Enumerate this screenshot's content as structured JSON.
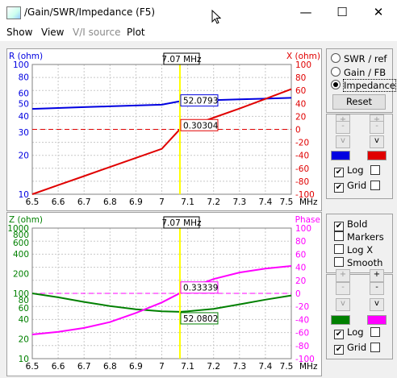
{
  "window": {
    "title": "/Gain/SWR/Impedance (F5)",
    "minimize": "—",
    "maximize": "☐",
    "close": "✕"
  },
  "menu": [
    "Show",
    "View",
    "V/I source",
    "Plot"
  ],
  "cursor_freq_label": "7.07 MHz",
  "top_panel": {
    "left_axis_title": "R (ohm)",
    "right_axis_title": "X (ohm)",
    "left_ticks": [
      "100",
      "80",
      "60",
      "50",
      "40",
      "30",
      "20",
      "10"
    ],
    "right_ticks": [
      "100",
      "80",
      "60",
      "40",
      "20",
      "0",
      "-20",
      "-40",
      "-60",
      "-80",
      "-100"
    ],
    "x_ticks": [
      "6.5",
      "6.6",
      "6.7",
      "6.8",
      "6.9",
      "7",
      "7.1",
      "7.2",
      "7.3",
      "7.4",
      "7.5"
    ],
    "x_unit": "MHz",
    "r_readout": "52.0793",
    "x_readout": "0.30304"
  },
  "bottom_panel": {
    "left_axis_title": "Z (ohm)",
    "right_axis_title": "Phase",
    "left_ticks": [
      "1000",
      "800",
      "600",
      "400",
      "200",
      "100",
      "80",
      "60",
      "40",
      "20",
      "10"
    ],
    "right_ticks": [
      "100",
      "80",
      "60",
      "40",
      "20",
      "0",
      "-20",
      "-40",
      "-60",
      "-80",
      "-100"
    ],
    "x_ticks": [
      "6.5",
      "6.6",
      "6.7",
      "6.8",
      "6.9",
      "7",
      "7.1",
      "7.2",
      "7.3",
      "7.4",
      "7.5"
    ],
    "x_unit": "MHz",
    "phase_readout": "0.33339",
    "z_readout": "52.0802"
  },
  "top_side": {
    "modes": [
      "SWR / ref",
      "Gain / FB",
      "Impedance"
    ],
    "selected_mode": "Impedance",
    "reset_label": "Reset",
    "plus_btn": "+",
    "minus_btn": "-",
    "up_btn": "^",
    "down_btn": "v",
    "log_label": "Log",
    "grid_label": "Grid",
    "log_checked": true,
    "grid_checked": true
  },
  "bottom_side": {
    "bold_label": "Bold",
    "markers_label": "Markers",
    "logx_label": "Log X",
    "smooth_label": "Smooth",
    "bold_checked": true,
    "plus_btn": "+",
    "minus_btn": "-",
    "up_btn": "^",
    "down_btn": "v",
    "log_label": "Log",
    "grid_label": "Grid",
    "log_checked": true,
    "grid_checked": true
  },
  "colors": {
    "r_series": "#0000e0",
    "x_series": "#e00000",
    "z_series": "#008000",
    "phase_series": "#ff00ff",
    "cursor": "#ffff00"
  },
  "chart_data": [
    {
      "type": "line",
      "x": [
        6.5,
        6.6,
        6.7,
        6.8,
        6.9,
        7.0,
        7.07,
        7.1,
        7.2,
        7.3,
        7.4,
        7.5
      ],
      "series": [
        {
          "name": "R (ohm)",
          "values": [
            45.5,
            46.2,
            46.9,
            47.6,
            48.3,
            49.0,
            52.08,
            52.3,
            53.1,
            53.8,
            54.5,
            55.3
          ]
        },
        {
          "name": "X (ohm)",
          "values": [
            -100,
            -86,
            -72,
            -58,
            -44,
            -30,
            0.30304,
            4,
            18,
            32,
            47,
            62
          ]
        }
      ],
      "xlabel": "MHz",
      "ylabel": "R (ohm)",
      "y2label": "X (ohm)",
      "xlim": [
        6.5,
        7.5
      ],
      "ylim": [
        10,
        100
      ],
      "y2lim": [
        -100,
        100
      ],
      "cursor_x": 7.07,
      "grid": true,
      "log_y": true
    },
    {
      "type": "line",
      "x": [
        6.5,
        6.6,
        6.7,
        6.8,
        6.9,
        7.0,
        7.07,
        7.1,
        7.2,
        7.3,
        7.4,
        7.5
      ],
      "series": [
        {
          "name": "Z (ohm)",
          "values": [
            100,
            87,
            74,
            64,
            57,
            53,
            52.08,
            53,
            58,
            68,
            80,
            93
          ]
        },
        {
          "name": "Phase",
          "values": [
            -63,
            -59,
            -53,
            -44,
            -30,
            -14,
            0.33339,
            7,
            22,
            32,
            38,
            42
          ]
        }
      ],
      "xlabel": "MHz",
      "ylabel": "Z (ohm)",
      "y2label": "Phase",
      "xlim": [
        6.5,
        7.5
      ],
      "ylim": [
        10,
        1000
      ],
      "y2lim": [
        -100,
        100
      ],
      "cursor_x": 7.07,
      "grid": true,
      "log_y": true
    }
  ]
}
